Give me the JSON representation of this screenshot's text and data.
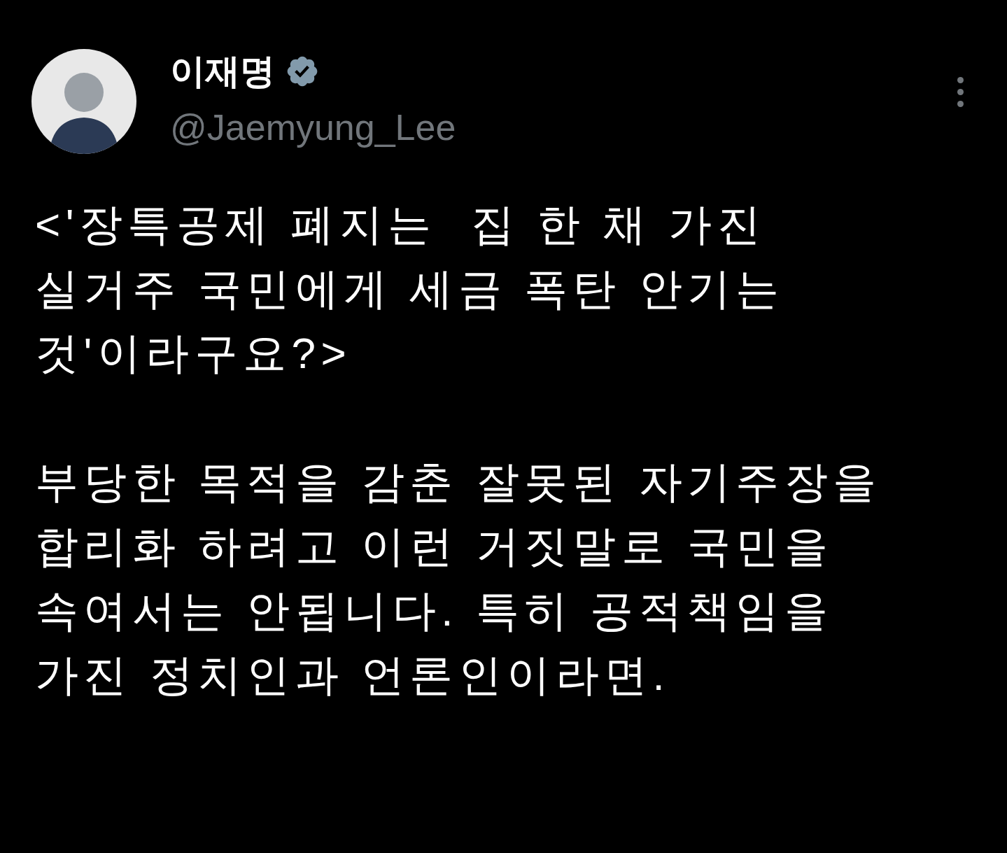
{
  "author": {
    "name": "이재명",
    "verified": true,
    "handle": "@Jaemyung_Lee"
  },
  "paragraphs": [
    [
      "<'장특공제 폐지는  집 한 채 가진",
      "실거주 국민에게 세금 폭탄 안기는",
      "것'이라구요?>"
    ],
    [
      "부당한 목적을 감춘 잘못된 자기주장을",
      "합리화 하려고 이런 거짓말로 국민을",
      "속여서는 안됩니다. 특히 공적책임을",
      "가진 정치인과 언론인이라면."
    ]
  ]
}
